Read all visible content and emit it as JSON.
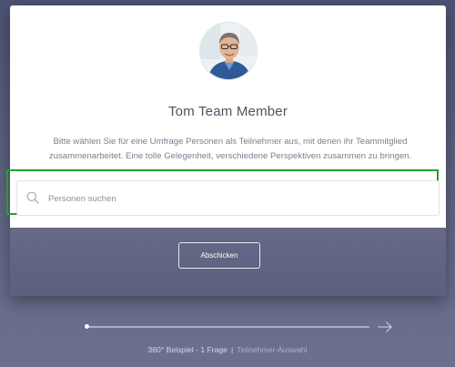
{
  "profile": {
    "name": "Tom Team Member",
    "description": "Bitte wählen Sie für eine Umfrage Personen als Teilnehmer aus, mit denen ihr Teammitglied zusammenarbeitet. Eine tolle Gelegenheit, verschiedene Perspektiven zusammen zu bringen."
  },
  "search": {
    "placeholder": "Personen suchen",
    "value": "",
    "icon": "search-icon"
  },
  "actions": {
    "submit_label": "Abschicken"
  },
  "progress": {
    "fraction": 0.0,
    "next_icon": "arrow-right-icon"
  },
  "footer": {
    "survey": "360° Beispiel - 1 Frage",
    "separator": "|",
    "step": "Teilnehmer-Auswahl"
  },
  "colors": {
    "highlight": "#22a12c",
    "background": "#5b607d",
    "card": "#ffffff"
  }
}
